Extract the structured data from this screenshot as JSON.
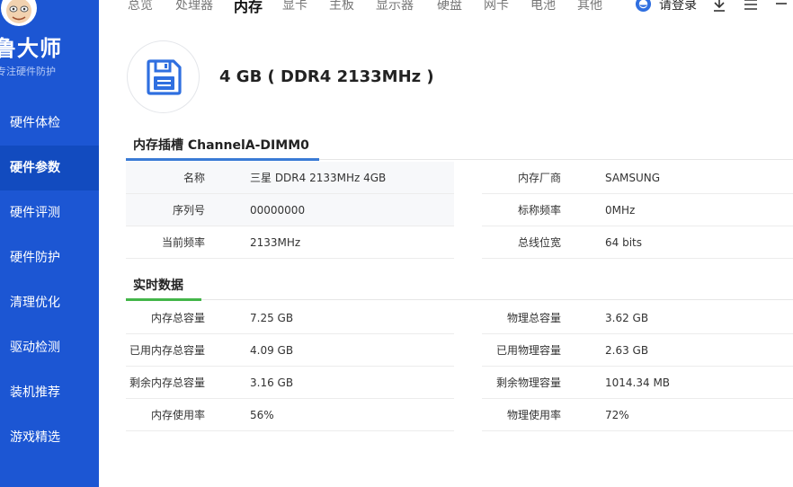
{
  "app": {
    "logo_title": "鲁大师",
    "logo_subtitle": "专注硬件防护"
  },
  "sidebar": {
    "items": [
      {
        "label": "硬件体检"
      },
      {
        "label": "硬件参数",
        "active": true
      },
      {
        "label": "硬件评测"
      },
      {
        "label": "硬件防护"
      },
      {
        "label": "清理优化"
      },
      {
        "label": "驱动检测"
      },
      {
        "label": "装机推荐"
      },
      {
        "label": "游戏精选"
      }
    ]
  },
  "topnav": {
    "tabs": [
      {
        "label": "总览"
      },
      {
        "label": "处理器"
      },
      {
        "label": "内存",
        "active": true
      },
      {
        "label": "显卡"
      },
      {
        "label": "主板"
      },
      {
        "label": "显示器"
      },
      {
        "label": "硬盘"
      },
      {
        "label": "网卡"
      },
      {
        "label": "电池"
      },
      {
        "label": "其他"
      }
    ],
    "login_label": "请登录",
    "icons": [
      "login-icon",
      "download-icon",
      "menu-icon",
      "more-icon"
    ]
  },
  "header": {
    "title": "4 GB ( DDR4 2133MHz )",
    "icon": "floppy-disk-icon"
  },
  "slot_section": {
    "title": "内存插槽 ChannelA-DIMM0",
    "accent": "#3a7bd5",
    "left": [
      {
        "label": "名称",
        "value": "三星 DDR4 2133MHz 4GB"
      },
      {
        "label": "序列号",
        "value": "00000000"
      },
      {
        "label": "当前频率",
        "value": "2133MHz"
      }
    ],
    "right": [
      {
        "label": "内存厂商",
        "value": "SAMSUNG"
      },
      {
        "label": "标称频率",
        "value": "0MHz"
      },
      {
        "label": "总线位宽",
        "value": "64 bits"
      }
    ]
  },
  "realtime_section": {
    "title": "实时数据",
    "accent": "#43b649",
    "left": [
      {
        "label": "内存总容量",
        "value": "7.25 GB"
      },
      {
        "label": "已用内存总容量",
        "value": "4.09 GB"
      },
      {
        "label": "剩余内存总容量",
        "value": "3.16 GB"
      },
      {
        "label": "内存使用率",
        "value": "56%"
      }
    ],
    "right": [
      {
        "label": "物理总容量",
        "value": "3.62 GB"
      },
      {
        "label": "已用物理容量",
        "value": "2.63 GB"
      },
      {
        "label": "剩余物理容量",
        "value": "1014.34 MB"
      },
      {
        "label": "物理使用率",
        "value": "72%"
      }
    ]
  },
  "colors": {
    "sidebar_bg": "#1c56d3",
    "sidebar_active": "#124bbf",
    "icon_blue": "#2f6fe0"
  }
}
